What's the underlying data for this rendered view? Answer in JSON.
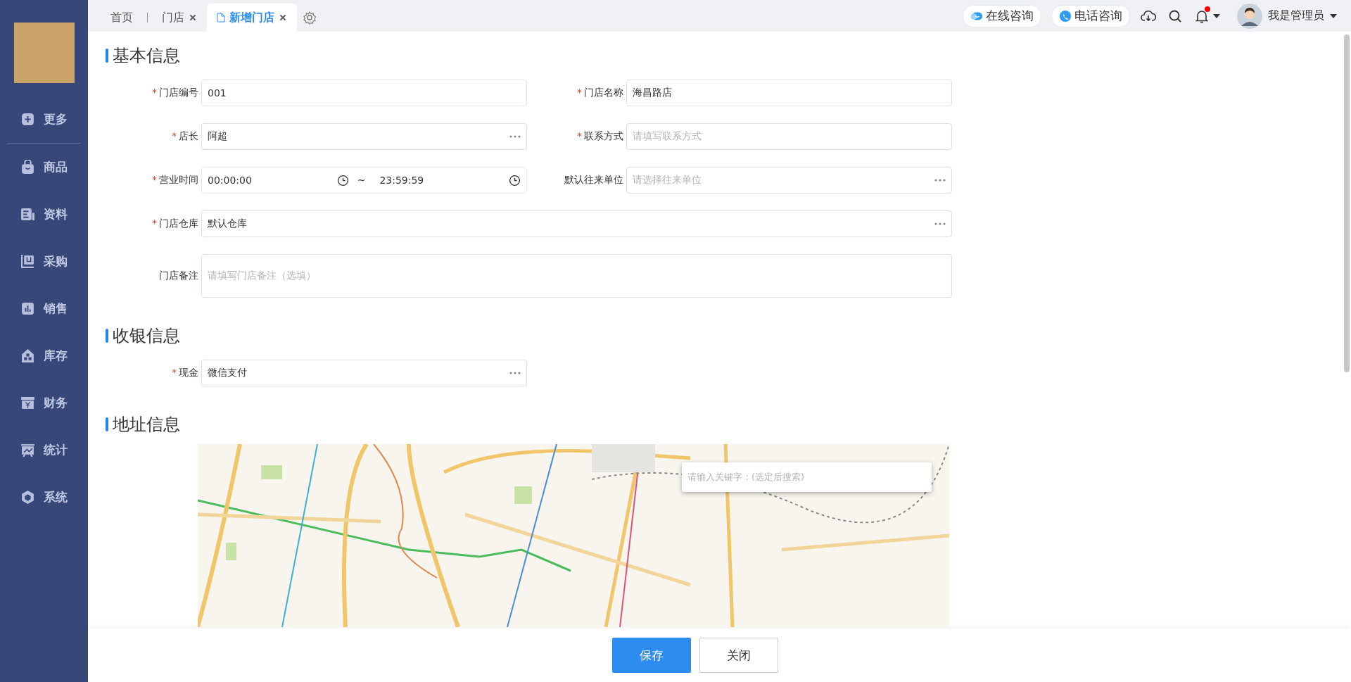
{
  "sidebar": {
    "items": [
      {
        "label": "更多",
        "divider_after": true
      },
      {
        "label": "商品",
        "divider_after": false
      },
      {
        "label": "资料",
        "divider_after": false
      },
      {
        "label": "采购",
        "divider_after": false
      },
      {
        "label": "销售",
        "divider_after": false
      },
      {
        "label": "库存",
        "divider_after": false
      },
      {
        "label": "财务",
        "divider_after": false
      },
      {
        "label": "统计",
        "divider_after": false
      },
      {
        "label": "系统",
        "divider_after": false
      }
    ]
  },
  "tabs": [
    {
      "label": "首页",
      "selected": false,
      "closable": false
    },
    {
      "label": "门店",
      "selected": false,
      "closable": true
    },
    {
      "label": "新增门店",
      "selected": true,
      "closable": true
    }
  ],
  "header": {
    "consult_buttons": [
      {
        "label": "在线咨询",
        "kind": "chat"
      },
      {
        "label": "电话咨询",
        "kind": "phone"
      }
    ],
    "has_unread": true,
    "user": "我是管理员"
  },
  "sections": [
    {
      "title": "基本信息",
      "fields": [
        {
          "label": "门店编号",
          "required_mark": "*",
          "kind": "text",
          "value": "001",
          "wide": false
        },
        {
          "label": "门店名称",
          "required_mark": "*",
          "kind": "text",
          "value": "海昌路店",
          "wide": false
        },
        {
          "label": "店长",
          "required_mark": "*",
          "kind": "picker",
          "value": "阿超",
          "wide": false
        },
        {
          "label": "联系方式",
          "required_mark": "*",
          "kind": "text",
          "placeholder": "请填写联系方式",
          "wide": false
        },
        {
          "label": "营业时间",
          "required_mark": "*",
          "kind": "time-range",
          "start": "00:00:00",
          "separator": "~",
          "end": "23:59:59",
          "wide": false
        },
        {
          "label": "默认往来单位",
          "kind": "picker",
          "placeholder": "请选择往来单位",
          "wide": false
        },
        {
          "label": "门店仓库",
          "required_mark": "*",
          "kind": "picker",
          "value": "默认仓库",
          "wide": true
        },
        {
          "label": "门店备注",
          "kind": "textarea",
          "placeholder": "请填写门店备注（选填）",
          "wide": true
        }
      ]
    },
    {
      "title": "收银信息",
      "fields": [
        {
          "label": "现金",
          "required_mark": "*",
          "kind": "picker",
          "value": "微信支付",
          "wide": false
        }
      ]
    },
    {
      "title": "地址信息",
      "map": {
        "search_placeholder": "请输入关键字：(选定后搜索)"
      }
    }
  ],
  "footer": {
    "buttons": [
      {
        "label": "保存",
        "kind": "primary"
      },
      {
        "label": "关闭",
        "kind": "default"
      }
    ]
  }
}
